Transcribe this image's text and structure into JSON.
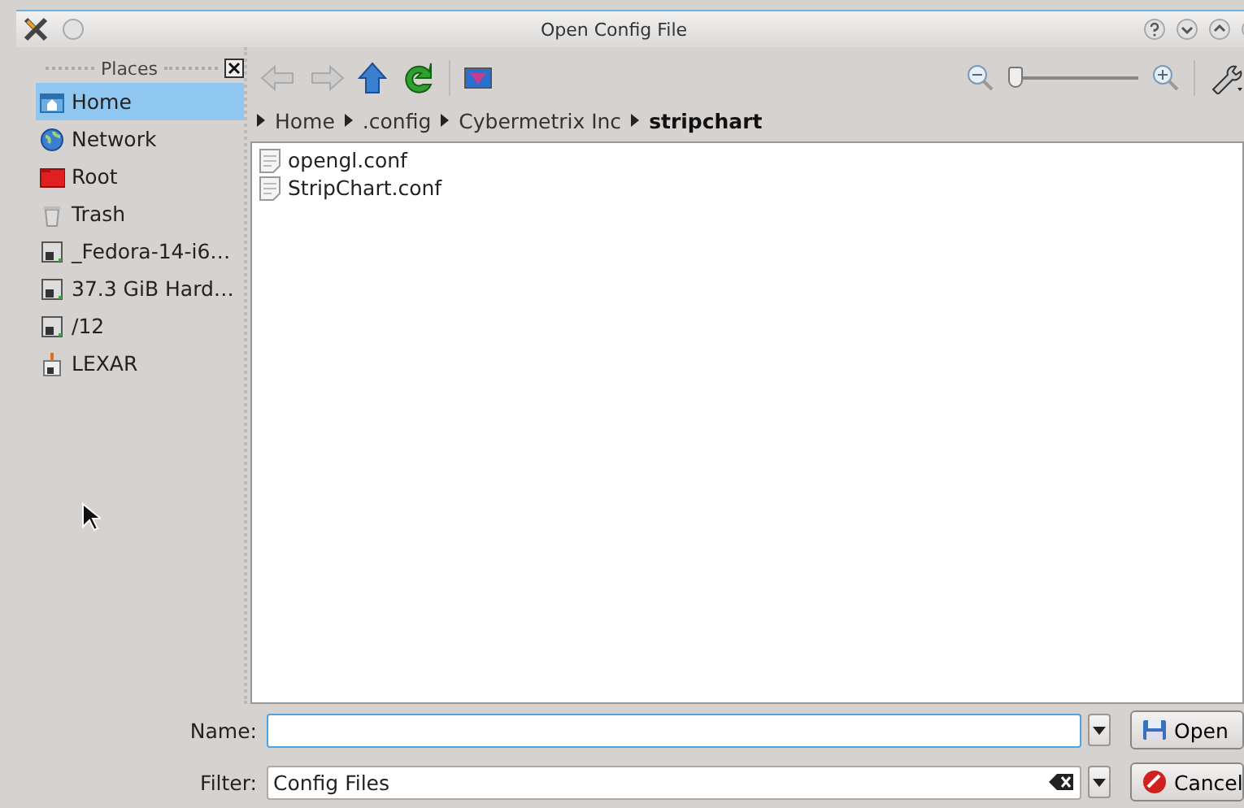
{
  "window": {
    "title": "Open Config File"
  },
  "places": {
    "title": "Places",
    "items": [
      {
        "label": "Home",
        "selected": true
      },
      {
        "label": "Network",
        "selected": false
      },
      {
        "label": "Root",
        "selected": false
      },
      {
        "label": "Trash",
        "selected": false
      },
      {
        "label": "_Fedora-14-i6…",
        "selected": false
      },
      {
        "label": "37.3 GiB Hard…",
        "selected": false
      },
      {
        "label": "/12",
        "selected": false
      },
      {
        "label": "LEXAR",
        "selected": false
      }
    ]
  },
  "zoom": {
    "level": 0.05
  },
  "breadcrumb": [
    {
      "label": "Home",
      "selected": false
    },
    {
      "label": ".config",
      "selected": false
    },
    {
      "label": "Cybermetrix Inc",
      "selected": false
    },
    {
      "label": "stripchart",
      "selected": true
    }
  ],
  "files": [
    "opengl.conf",
    "StripChart.conf"
  ],
  "name_field": {
    "label": "Name:"
  },
  "filter_field": {
    "label": "Filter:",
    "value": "Config Files"
  },
  "buttons": [
    "Open",
    "Cancel"
  ]
}
